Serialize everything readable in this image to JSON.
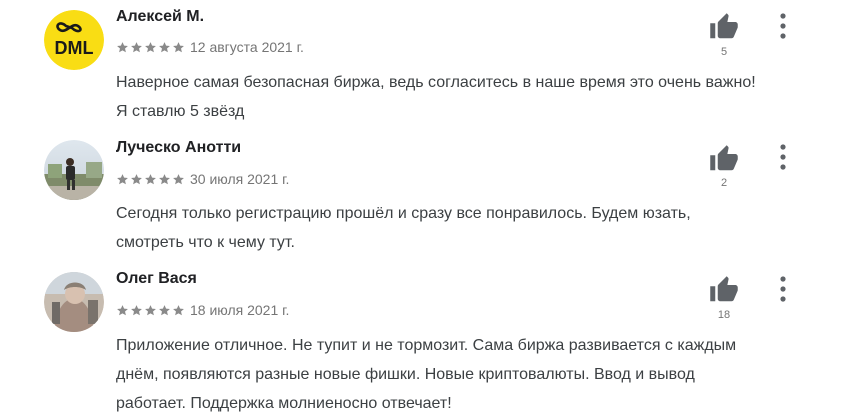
{
  "reviews": [
    {
      "author": "Алексей М.",
      "avatar_text": "DML",
      "rating": 5,
      "date": "12 августа 2021 г.",
      "lines": [
        "Наверное самая безопасная биржа, ведь согласитесь в наше время это очень важно!",
        "Я ставлю 5 звёзд"
      ],
      "likes": "5"
    },
    {
      "author": "Луческо Анотти",
      "rating": 5,
      "date": "30 июля 2021 г.",
      "lines": [
        "Сегодня только регистрацию прошёл и сразу все понравилось. Будем юзать,",
        "смотреть что к чему тут."
      ],
      "likes": "2"
    },
    {
      "author": "Олег Вася",
      "rating": 5,
      "date": "18 июля 2021 г.",
      "lines": [
        "Приложение отличное. Не тупит и не тормозит. Сама биржа развивается с каждым",
        "днём, появляются разные новые фишки. Новые криптовалюты. Ввод и вывод",
        "работает. Поддержка молниеносно отвечает!"
      ],
      "likes": "18"
    }
  ],
  "icons": {
    "thumb": "thumbs-up-icon",
    "more": "more-vert-icon",
    "star": "star-icon"
  },
  "colors": {
    "star": "#8a8a8a",
    "thumb": "#5f6368",
    "avatar_yellow": "#f9dd14"
  }
}
